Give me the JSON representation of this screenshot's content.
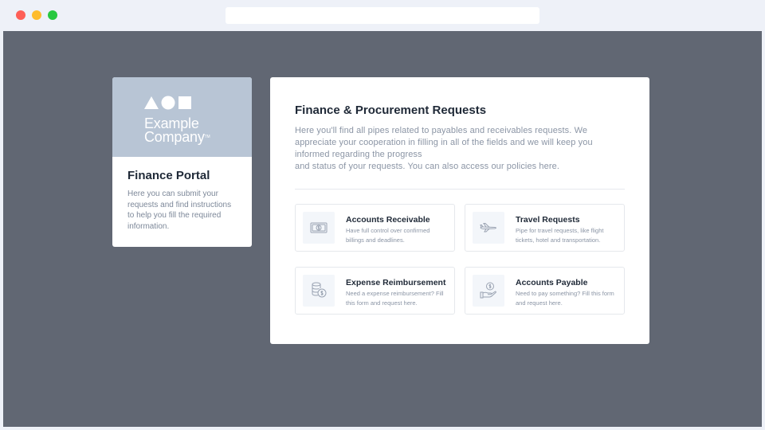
{
  "browser": {
    "url": ""
  },
  "sidebar_card": {
    "logo_line1": "Example",
    "logo_line2": "Company",
    "logo_tm": "TM",
    "title": "Finance Portal",
    "description": "Here you can submit your requests and find instructions to help you fill the required information."
  },
  "main": {
    "title": "Finance & Procurement Requests",
    "description_line1": "Here you'll find all pipes related to payables and receivables requests. We appreciate your cooperation in filling in all of the fields and we will keep you informed regarding the progress",
    "description_line2": "and status of your requests. You can also access our policies here.",
    "tiles": [
      {
        "title": "Accounts Receivable",
        "description": "Have full control over confirmed billings and deadlines.",
        "icon": "dollar-bill-icon"
      },
      {
        "title": "Travel Requests",
        "description": "Pipe for travel requests, like flight tickets, hotel and transportation.",
        "icon": "airplane-icon"
      },
      {
        "title": "Expense Reimbursement",
        "description": "Need a expense reimbursement? Fill this form and request here.",
        "icon": "coins-icon"
      },
      {
        "title": "Accounts Payable",
        "description": "Need to pay something? Fill this form and request here.",
        "icon": "hand-dollar-icon"
      }
    ]
  },
  "colors": {
    "background": "#616773",
    "banner": "#b8c5d5",
    "heading": "#1f2937",
    "muted": "#8b95a5"
  }
}
